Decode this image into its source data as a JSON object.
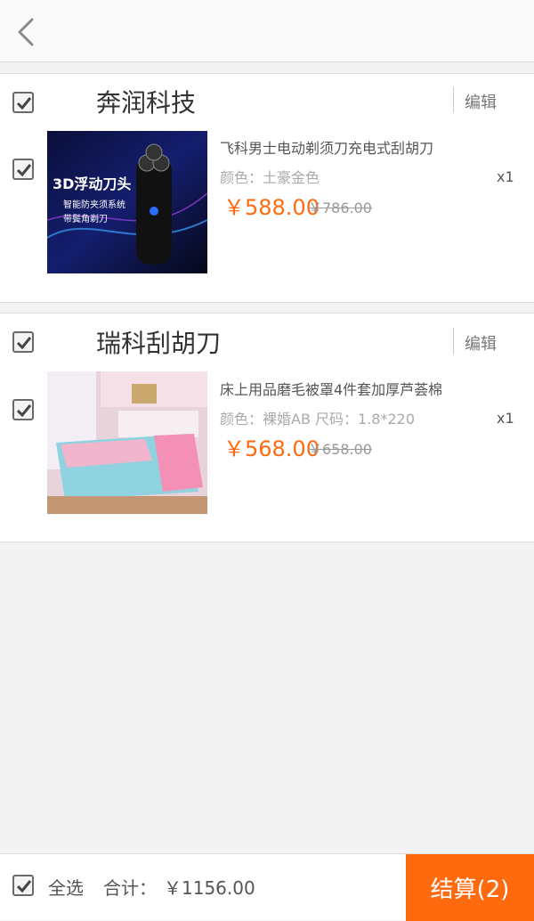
{
  "header": {
    "back_icon": "chevron-left-icon"
  },
  "shops": [
    {
      "name": "奔润科技",
      "edit_label": "编辑",
      "product": {
        "title": "飞科男士电动剃须刀充电式刮胡刀",
        "attrs": "颜色：土豪金色",
        "price": "￥588.00",
        "original_price": "￥786.00",
        "quantity": "x1",
        "image_text_line1": "3D浮动刀头",
        "image_text_line2": "智能防夹须系统",
        "image_text_line3": "带鬓角剃刀"
      }
    },
    {
      "name": "瑞科刮胡刀",
      "edit_label": "编辑",
      "product": {
        "title": "床上用品磨毛被罩4件套加厚芦荟棉",
        "attrs": "颜色：裸婚AB  尺码：1.8*220",
        "price": "￥568.00",
        "original_price": "￥658.00",
        "quantity": "x1"
      }
    }
  ],
  "footer": {
    "select_all_label": "全选",
    "total_label": "合计：",
    "total_value": "￥1156.00",
    "checkout_label": "结算(2)"
  },
  "colors": {
    "accent": "#ff6a0e",
    "background": "#f3f3f3"
  }
}
